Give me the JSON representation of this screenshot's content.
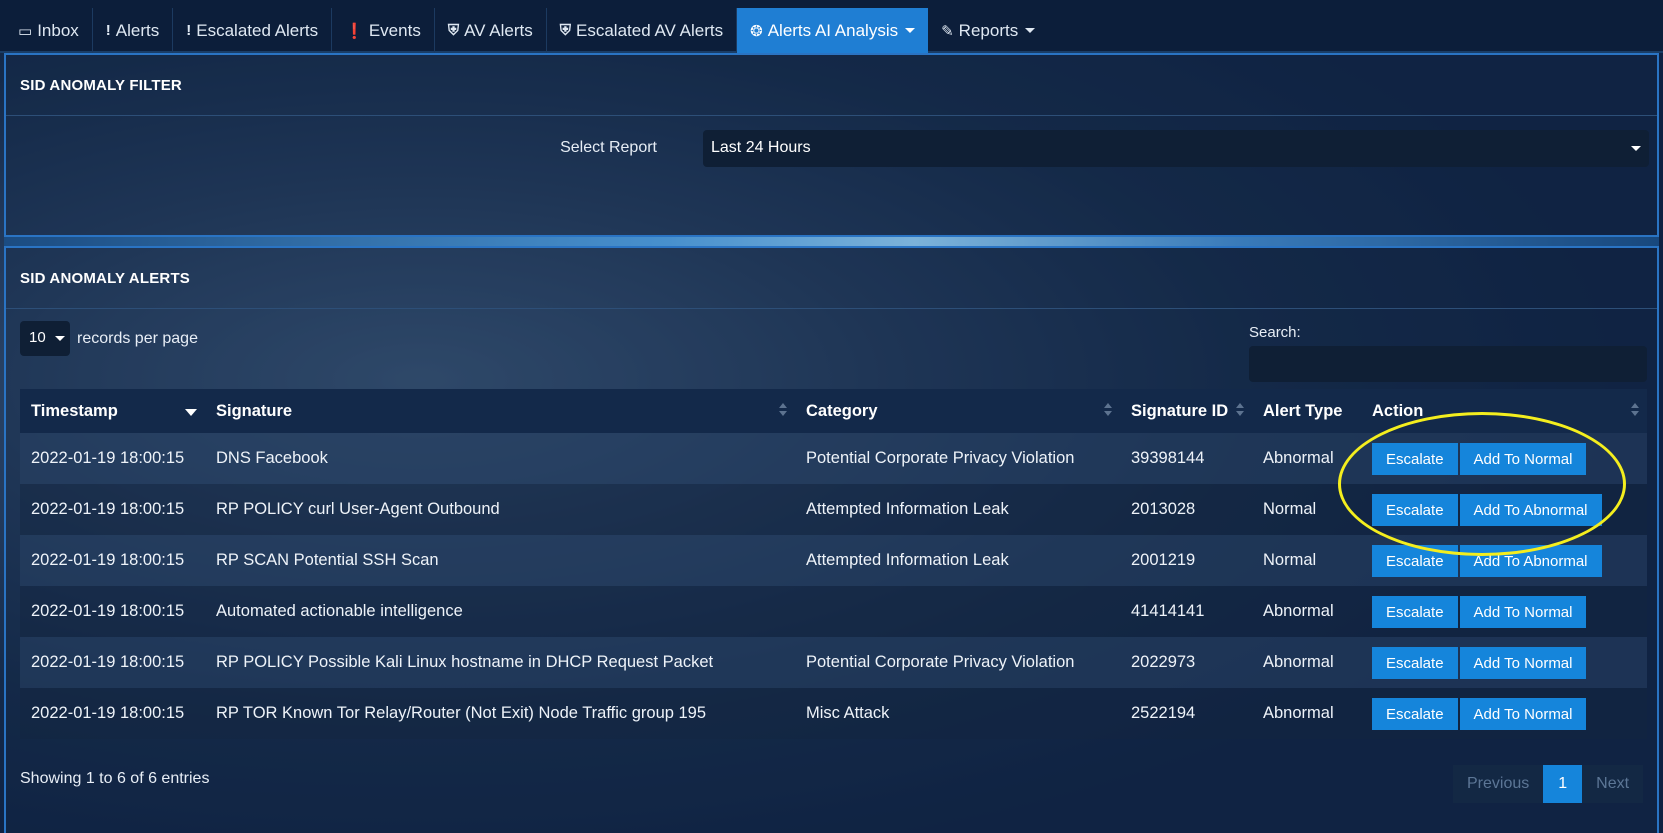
{
  "nav": {
    "tabs": [
      {
        "label": "Inbox",
        "icon": "inbox-icon"
      },
      {
        "label": "Alerts",
        "icon": "exclamation-icon"
      },
      {
        "label": "Escalated Alerts",
        "icon": "exclamation-icon"
      },
      {
        "label": "Events",
        "icon": "exclamation-circle-icon"
      },
      {
        "label": "AV Alerts",
        "icon": "shield-icon"
      },
      {
        "label": "Escalated AV Alerts",
        "icon": "shield-icon"
      },
      {
        "label": "Alerts AI Analysis",
        "icon": "gear-icon",
        "active": true
      },
      {
        "label": "Reports",
        "icon": "pencil-icon"
      }
    ]
  },
  "filter_panel": {
    "title": "SID ANOMALY FILTER",
    "select_label": "Select Report",
    "select_value": "Last 24 Hours"
  },
  "alerts_panel": {
    "title": "SID ANOMALY ALERTS",
    "per_page_value": "10",
    "per_page_label": "records per page",
    "search_label": "Search:",
    "search_value": "",
    "columns": [
      "Timestamp",
      "Signature",
      "Category",
      "Signature ID",
      "Alert Type",
      "Action"
    ],
    "rows": [
      {
        "timestamp": "2022-01-19 18:00:15",
        "signature": "DNS Facebook",
        "category": "Potential Corporate Privacy Violation",
        "sid": "39398144",
        "type": "Abnormal",
        "action2": "Add To Normal"
      },
      {
        "timestamp": "2022-01-19 18:00:15",
        "signature": "RP POLICY curl User-Agent Outbound",
        "category": "Attempted Information Leak",
        "sid": "2013028",
        "type": "Normal",
        "action2": "Add To Abnormal"
      },
      {
        "timestamp": "2022-01-19 18:00:15",
        "signature": "RP SCAN Potential SSH Scan",
        "category": "Attempted Information Leak",
        "sid": "2001219",
        "type": "Normal",
        "action2": "Add To Abnormal"
      },
      {
        "timestamp": "2022-01-19 18:00:15",
        "signature": "Automated actionable intelligence",
        "category": "",
        "sid": "41414141",
        "type": "Abnormal",
        "action2": "Add To Normal"
      },
      {
        "timestamp": "2022-01-19 18:00:15",
        "signature": "RP POLICY Possible Kali Linux hostname in DHCP Request Packet",
        "category": "Potential Corporate Privacy Violation",
        "sid": "2022973",
        "type": "Abnormal",
        "action2": "Add To Normal"
      },
      {
        "timestamp": "2022-01-19 18:00:15",
        "signature": "RP TOR Known Tor Relay/Router (Not Exit) Node Traffic group 195",
        "category": "Misc Attack",
        "sid": "2522194",
        "type": "Abnormal",
        "action2": "Add To Normal"
      }
    ],
    "escalate_label": "Escalate",
    "info": "Showing 1 to 6 of 6 entries",
    "pager": {
      "previous": "Previous",
      "current": "1",
      "next": "Next"
    }
  },
  "colors": {
    "accent": "#1585db",
    "highlight": "#f4ee1e"
  }
}
